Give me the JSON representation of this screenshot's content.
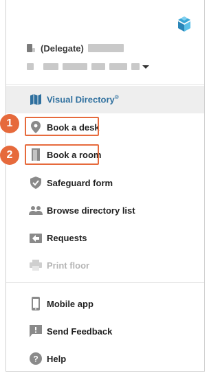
{
  "user": {
    "delegate_label": "(Delegate)"
  },
  "menu": {
    "items": [
      {
        "label": "Visual Directory",
        "suffix": "®",
        "icon": "map-icon",
        "active": true
      },
      {
        "label": "Book a desk",
        "icon": "location-pin-icon"
      },
      {
        "label": "Book a room",
        "icon": "door-icon"
      },
      {
        "label": "Safeguard form",
        "icon": "shield-check-icon"
      },
      {
        "label": "Browse directory list",
        "icon": "people-icon"
      },
      {
        "label": "Requests",
        "icon": "requests-icon"
      },
      {
        "label": "Print floor",
        "icon": "printer-icon",
        "disabled": true
      }
    ],
    "secondary": [
      {
        "label": "Mobile app",
        "icon": "mobile-phone-icon"
      },
      {
        "label": "Send Feedback",
        "icon": "feedback-icon"
      },
      {
        "label": "Help",
        "icon": "help-icon"
      }
    ]
  },
  "callouts": [
    {
      "number": "1"
    },
    {
      "number": "2"
    }
  ],
  "colors": {
    "accent": "#2e6f9e",
    "callout": "#e66a3c",
    "active_bg": "#eeeeee"
  }
}
